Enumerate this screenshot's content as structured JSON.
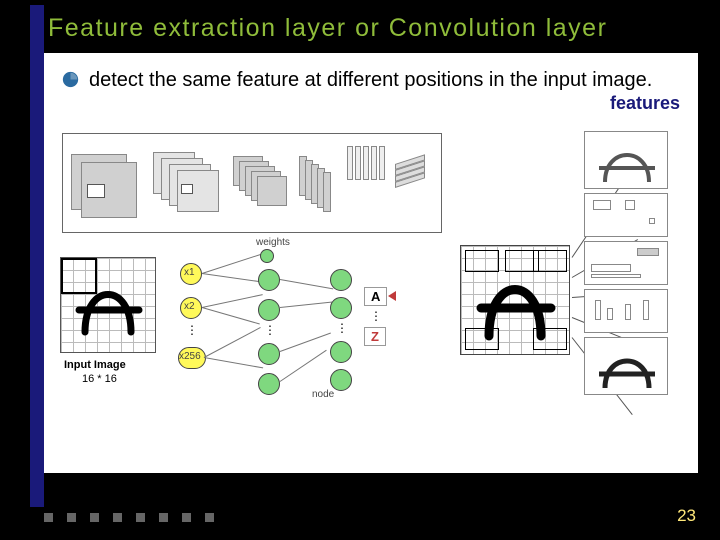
{
  "slide": {
    "title": "Feature extraction layer or Convolution layer",
    "bullet": "detect the same feature at different positions in the input image.",
    "features_label": "features",
    "input_caption": "Input Image",
    "input_dims": "16 * 16",
    "weights_label": "weights",
    "nodes_label": "node",
    "input_nodes": {
      "x1": "x1",
      "x2": "x2",
      "xlast": "x256"
    },
    "output_letters": {
      "a": "A",
      "z": "Z"
    },
    "page_number": "23"
  }
}
